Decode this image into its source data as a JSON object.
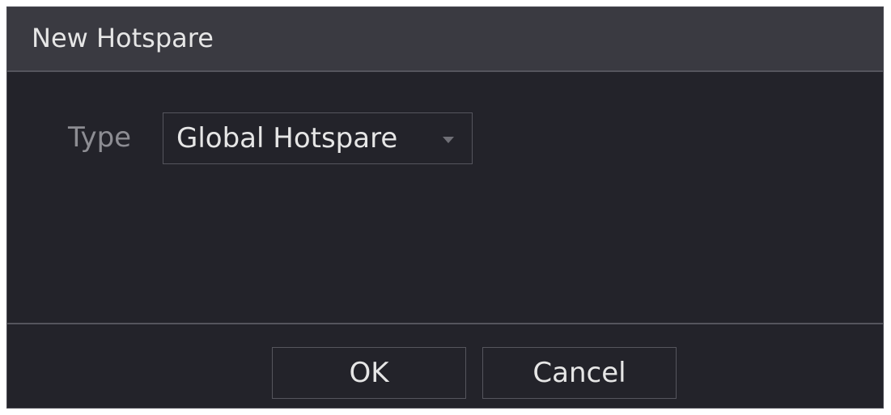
{
  "dialog": {
    "title": "New Hotspare",
    "type_label": "Type",
    "type_value": "Global Hotspare",
    "ok_label": "OK",
    "cancel_label": "Cancel"
  },
  "colors": {
    "background": "#23232a",
    "title_bar": "#3a3a41",
    "border": "#55555d",
    "text": "#e6e6e6",
    "label_text": "#8d8d93"
  },
  "icons": {
    "dropdown": "chevron-down-icon"
  }
}
